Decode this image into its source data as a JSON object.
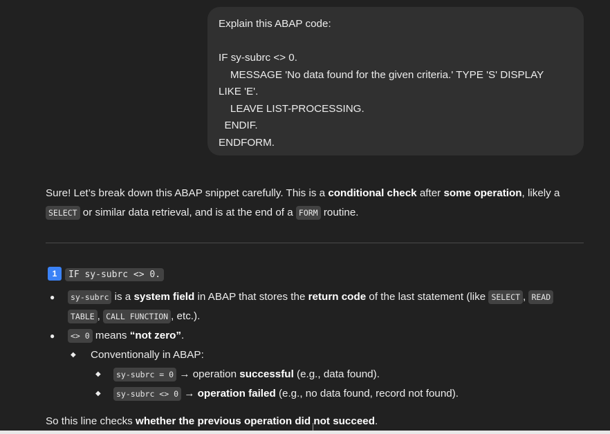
{
  "user_message": {
    "lines": [
      "Explain this ABAP code:",
      "",
      "IF sy-subrc <> 0.",
      "    MESSAGE 'No data found for the given criteria.' TYPE 'S' DISPLAY",
      "LIKE 'E'.",
      "    LEAVE LIST-PROCESSING.",
      "  ENDIF.",
      "ENDFORM."
    ]
  },
  "assistant": {
    "intro": {
      "t1": "Sure! Let’s break down this ABAP snippet carefully. This is a ",
      "b1": "conditional check",
      "t2": " after ",
      "b2": "some operation",
      "t3": ", likely a",
      "c1": "SELECT",
      "t4": " or similar data retrieval, and is at the end of a ",
      "c2": "FORM",
      "t5": " routine."
    },
    "section1": {
      "number": "1",
      "code": "IF sy-subrc <> 0.",
      "item1": {
        "c1": "sy-subrc",
        "t1": " is a ",
        "b1": "system field",
        "t2": " in ABAP that stores the ",
        "b2": "return code",
        "t3": " of the last statement (like ",
        "c2": "SELECT",
        "t4": ", ",
        "c3": "READ",
        "c4": "TABLE",
        "t5": ", ",
        "c5": "CALL FUNCTION",
        "t6": ", etc.)."
      },
      "item2": {
        "c1": "<> 0",
        "t1": " means ",
        "b1": "“not zero”",
        "t2": "."
      },
      "item3": {
        "t1": "Conventionally in ABAP:"
      },
      "item4": {
        "c1": "sy-subrc = 0",
        "t1": " → operation ",
        "b1": "successful",
        "t2": " (e.g., data found)."
      },
      "item5": {
        "c1": "sy-subrc <> 0",
        "t1": " → ",
        "b1": "operation failed",
        "t2": " (e.g., no data found, record not found)."
      }
    },
    "outro": {
      "t1": "So this line checks ",
      "b1": "whether the previous operation did not succeed",
      "t2": "."
    }
  }
}
